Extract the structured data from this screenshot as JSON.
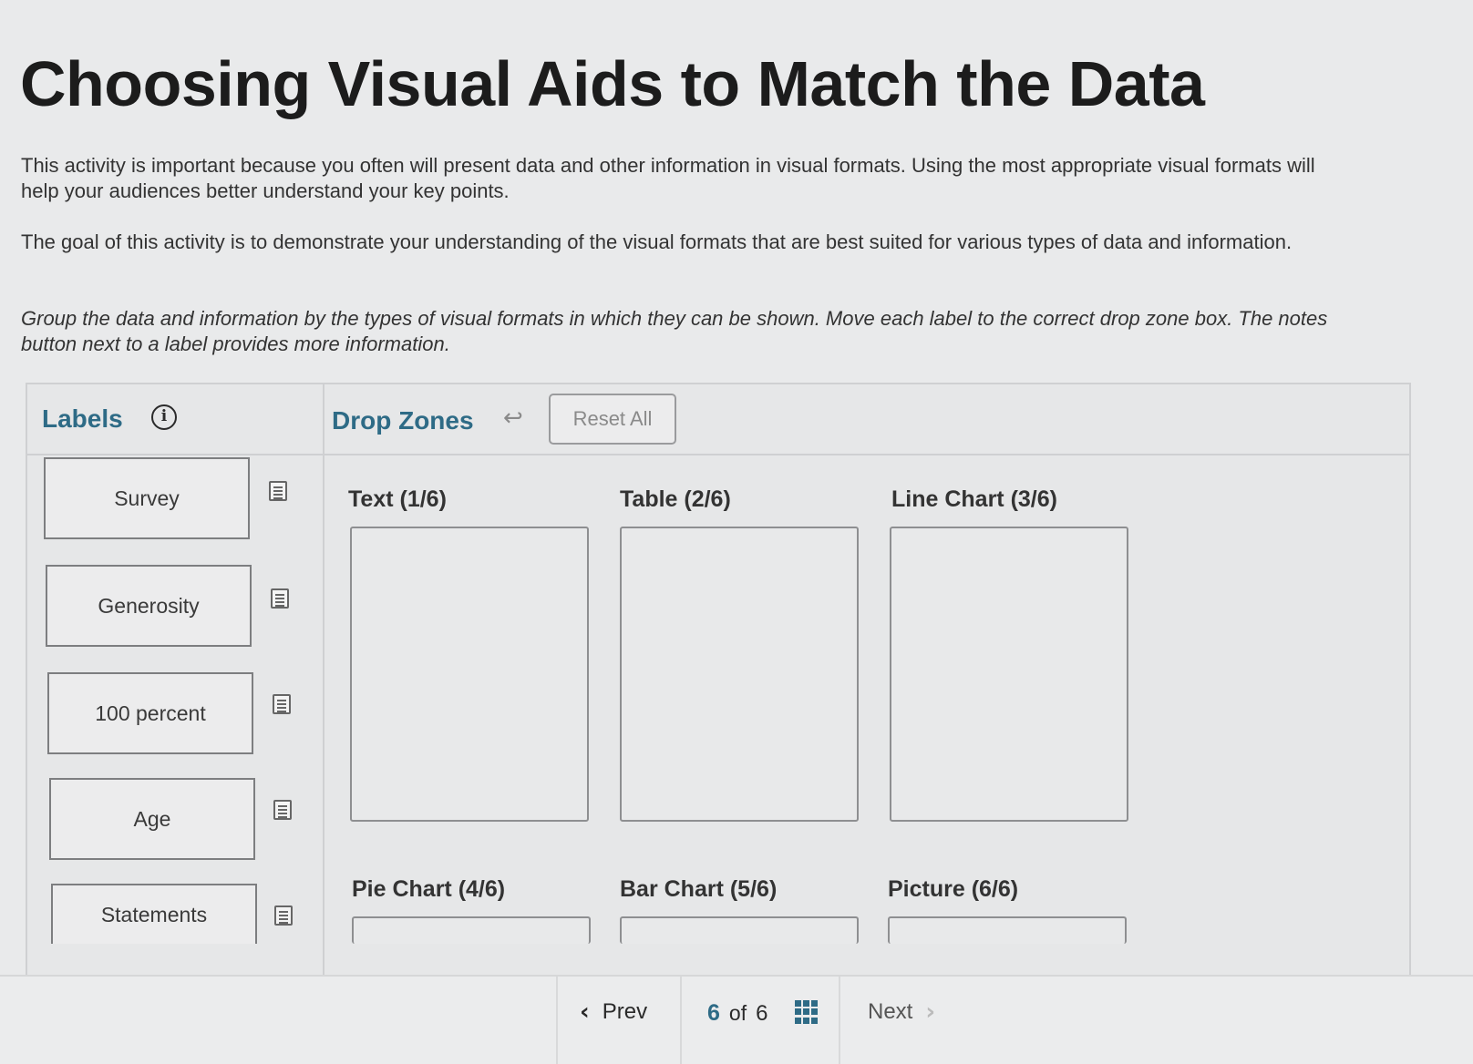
{
  "title": "Choosing Visual Aids to Match the Data",
  "intro": {
    "p1": "This activity is important because you often will present data and other information in visual formats. Using the most appropriate visual formats will help your audiences better understand your key points.",
    "p2": "The goal of this activity is to demonstrate your understanding of the visual formats that are best suited for various types of data and information.",
    "p3": "Group the data and information by the types of visual formats in which they can be shown. Move each label to the correct drop zone box. The notes button next to a label provides more information."
  },
  "labels": {
    "heading": "Labels",
    "info_icon": "info-icon",
    "items": [
      {
        "text": "Survey",
        "icon": "notes-icon"
      },
      {
        "text": "Generosity",
        "icon": "notes-icon"
      },
      {
        "text": "100 percent",
        "icon": "notes-icon"
      },
      {
        "text": "Age",
        "icon": "notes-icon"
      },
      {
        "text": "Statements",
        "icon": "notes-icon"
      }
    ]
  },
  "drop_zones": {
    "heading": "Drop Zones",
    "undo_icon": "undo-icon",
    "reset_label": "Reset All",
    "zones": [
      {
        "title": "Text (1/6)"
      },
      {
        "title": "Table (2/6)"
      },
      {
        "title": "Line Chart (3/6)"
      },
      {
        "title": "Pie Chart (4/6)"
      },
      {
        "title": "Bar Chart (5/6)"
      },
      {
        "title": "Picture (6/6)"
      }
    ]
  },
  "nav": {
    "prev_label": "Prev",
    "page_current": "6",
    "page_of": "of",
    "page_total": "6",
    "next_label": "Next",
    "accent": "#2e6b86"
  }
}
